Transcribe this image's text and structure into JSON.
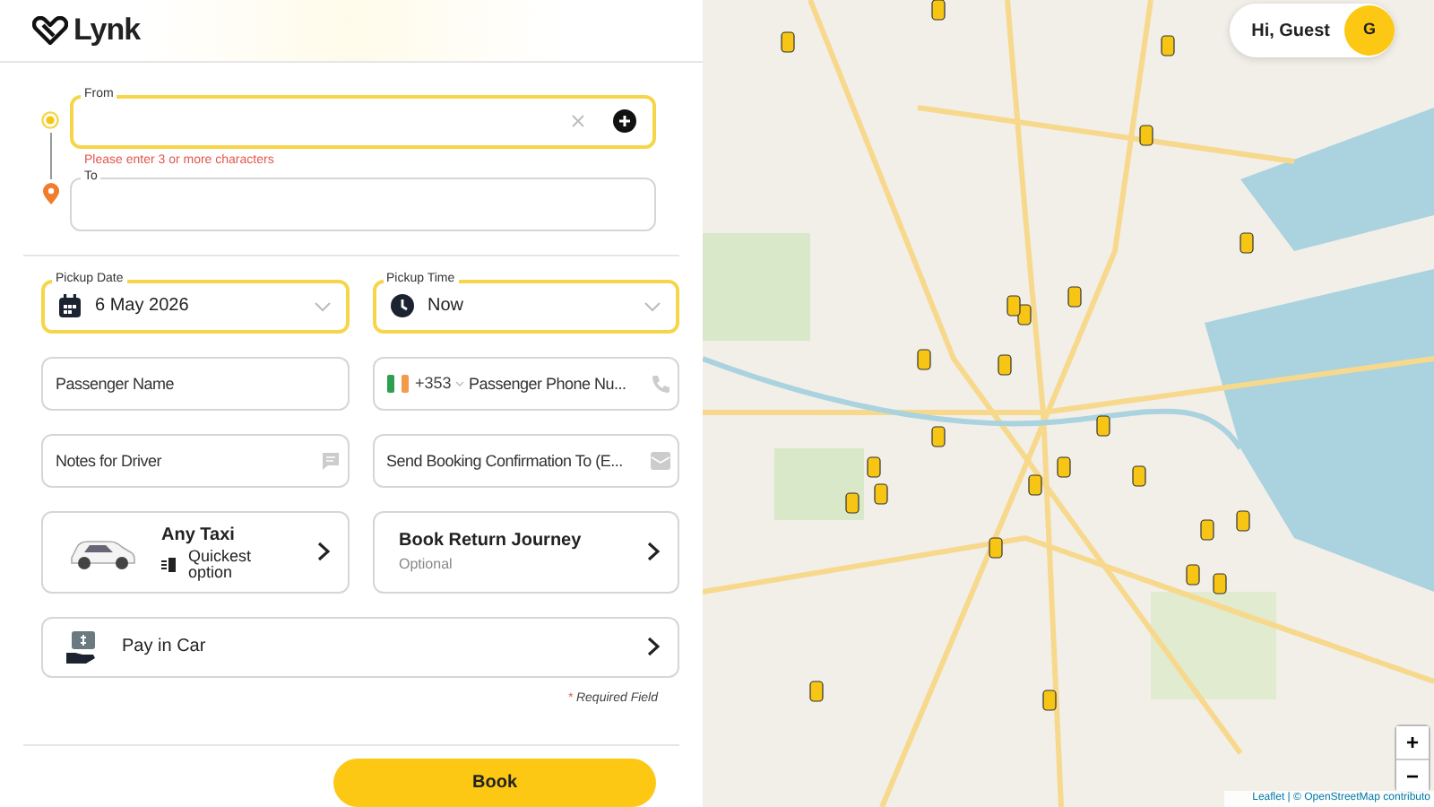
{
  "header": {
    "logo": "Lynk"
  },
  "route": {
    "from": {
      "label": "From",
      "focused": true,
      "error": "Please enter 3 or more characters"
    },
    "to": {
      "label": "To",
      "focused": false
    }
  },
  "pickup": [
    {
      "kind": "date",
      "label": "Pickup Date",
      "value": "6 May 2026",
      "focused": true
    },
    {
      "kind": "time",
      "label": "Pickup Time",
      "value": "Now",
      "focused": true
    }
  ],
  "fields": [
    {
      "kind": "name",
      "placeholder": "Passenger Name"
    },
    {
      "kind": "phone",
      "code": "+353",
      "placeholder": "Passenger Phone Nu..."
    },
    {
      "kind": "notes",
      "placeholder": "Notes for Driver"
    },
    {
      "kind": "email",
      "placeholder": "Send Booking Confirmation To (E..."
    }
  ],
  "vehicle": {
    "title": "Any Taxi",
    "subtitle": "Quickest option"
  },
  "return_journey": {
    "title": "Book Return Journey",
    "subtitle": "Optional"
  },
  "payment": {
    "title": "Pay in Car"
  },
  "required_note": {
    "marker": "*",
    "text": "Required Field"
  },
  "book_button": "Book",
  "map": {
    "greeting": "Hi, Guest",
    "avatar": "G",
    "zoom": [
      "+",
      "−"
    ],
    "attribution": "Leaflet | © OpenStreetMap contributo"
  }
}
